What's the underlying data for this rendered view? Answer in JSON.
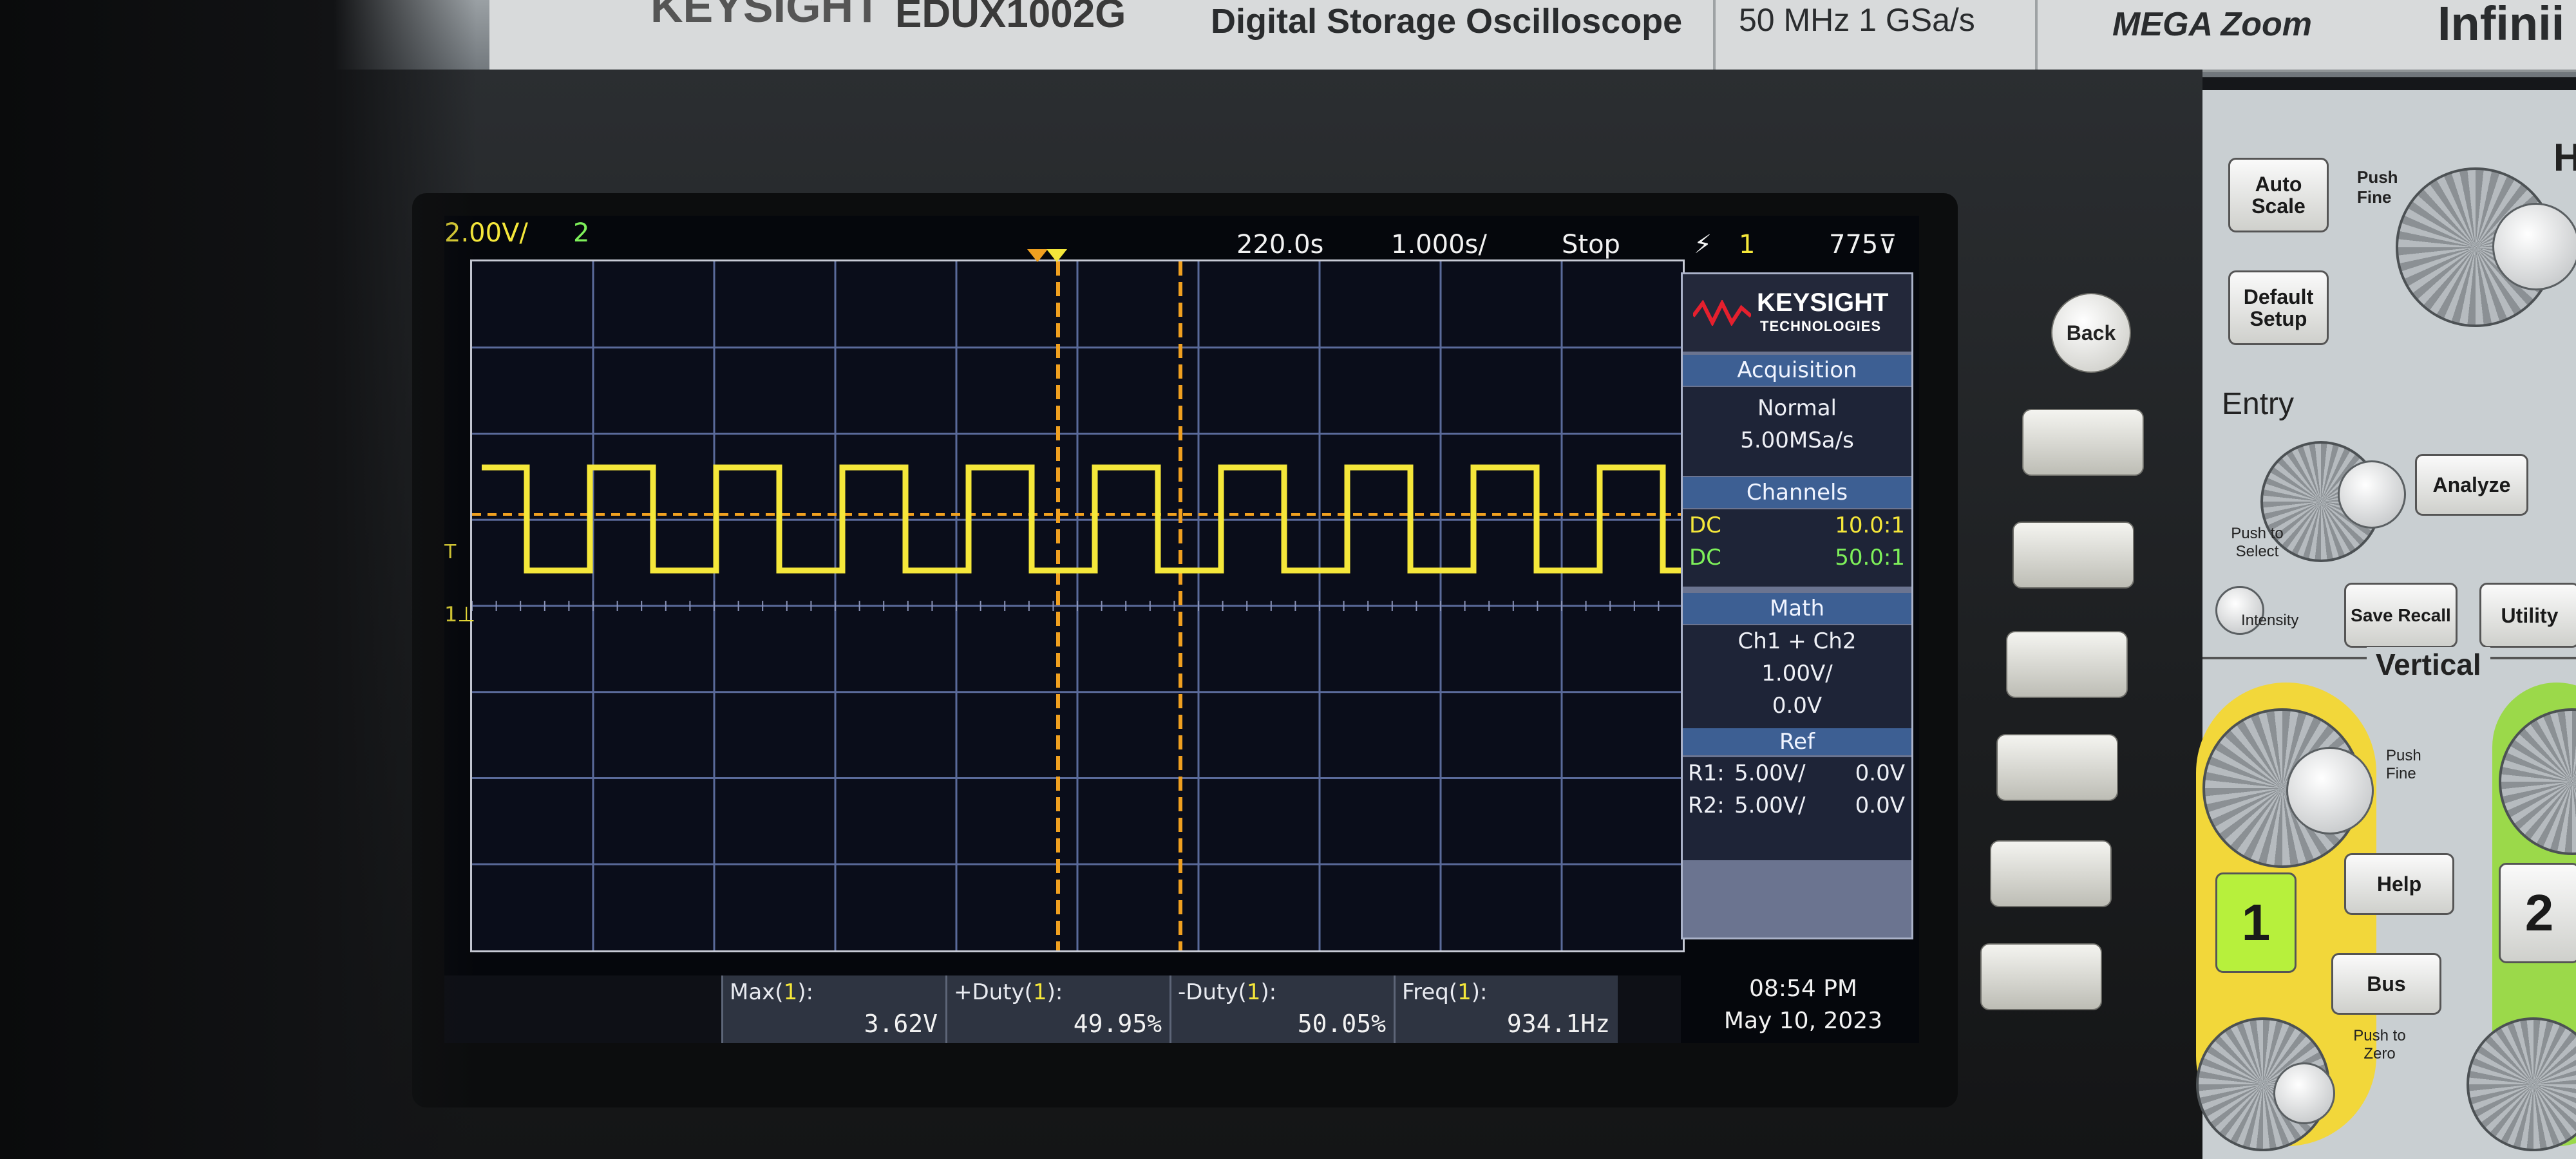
{
  "labels": {
    "brand": "KEYSIGHT",
    "model": "EDUX1002G",
    "product": "Digital Storage Oscilloscope",
    "spec": "50 MHz  1 GSa/s",
    "megazoom": "MEGA Zoom",
    "infiniivision": "Infinii"
  },
  "status_bar": {
    "ch1_scale": "2.00V/",
    "ch2_indicator": "2",
    "time_delay": "220.0s",
    "time_scale": "1.000s/",
    "run_state": "Stop",
    "trigger_edge": "⚡",
    "trigger_source": "1",
    "trigger_level": "775⊽"
  },
  "markers": {
    "ch1_ground": "1⊥",
    "trigger_marker": "T"
  },
  "panel": {
    "logo_top": "KEYSIGHT",
    "logo_bottom": "TECHNOLOGIES",
    "acquisition_title": "Acquisition",
    "acquisition_mode": "Normal",
    "acquisition_rate": "5.00MSa/s",
    "channels_title": "Channels",
    "channels": [
      {
        "coupling": "DC",
        "probe": "10.0:1",
        "color": "#f5e73a"
      },
      {
        "coupling": "DC",
        "probe": "50.0:1",
        "color": "#7ef05a"
      }
    ],
    "math_title": "Math",
    "math_func": "Ch1 + Ch2",
    "math_scale": "1.00V/",
    "math_offset": "0.0V",
    "ref_title": "Ref",
    "refs": [
      {
        "name": "R1:",
        "scale": "5.00V/",
        "offset": "0.0V"
      },
      {
        "name": "R2:",
        "scale": "5.00V/",
        "offset": "0.0V"
      }
    ]
  },
  "measurements": [
    {
      "label": "Max(",
      "ch": "1",
      "label_end": "):",
      "value": "3.62V"
    },
    {
      "label": "+Duty(",
      "ch": "1",
      "label_end": "):",
      "value": "49.95%"
    },
    {
      "label": "-Duty(",
      "ch": "1",
      "label_end": "):",
      "value": "50.05%"
    },
    {
      "label": "Freq(",
      "ch": "1",
      "label_end": "):",
      "value": "934.1Hz"
    }
  ],
  "clock": {
    "time": "08:54 PM",
    "date": "May 10, 2023"
  },
  "softkeys": {
    "back_label": "Back"
  },
  "controls": {
    "auto_scale": "Auto Scale",
    "push_fine_top": "Push Fine",
    "default_setup": "Default Setup",
    "horizontal_partial": "H",
    "entry": "Entry",
    "analyze": "Analyze",
    "push_to_select": "Push to Select",
    "intensity": "Intensity",
    "save_recall": "Save Recall",
    "utility": "Utility",
    "vertical": "Vertical",
    "push_fine_vertical": "Push Fine",
    "channel1": "1",
    "channel2": "2",
    "help": "Help",
    "bus": "Bus",
    "push_to_zero": "Push to Zero"
  },
  "colors": {
    "ch1": "#f5e73a",
    "ch2": "#7ef05a",
    "cursor": "#f0a020",
    "graticule": "#5a6a9a"
  }
}
